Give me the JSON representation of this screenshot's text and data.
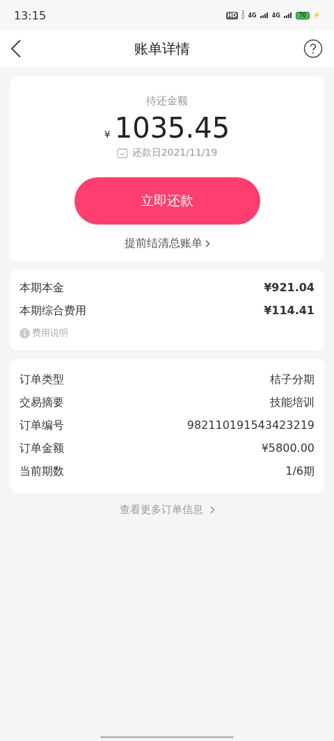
{
  "status_bar": {
    "time": "13:15",
    "hd": "HD",
    "hd_sims": [
      "1",
      "2"
    ],
    "networks": [
      "4G",
      "4G"
    ],
    "battery": "76",
    "charging": true
  },
  "nav": {
    "title": "账单详情"
  },
  "summary": {
    "label": "待还金额",
    "currency": "¥",
    "amount": "1035.45",
    "due": "还款日2021/11/19",
    "pay_button": "立即还款",
    "settle_link": "提前结清总账单"
  },
  "fees": {
    "rows": [
      {
        "label": "本期本金",
        "value": "¥921.04"
      },
      {
        "label": "本期综合费用",
        "value": "¥114.41"
      }
    ],
    "note": "费用说明"
  },
  "order": {
    "rows": [
      {
        "label": "订单类型",
        "value": "桔子分期"
      },
      {
        "label": "交易摘要",
        "value": "技能培训"
      },
      {
        "label": "订单编号",
        "value": "982110191543423219"
      },
      {
        "label": "订单金额",
        "value": "¥5800.00"
      },
      {
        "label": "当前期数",
        "value": "1/6期"
      }
    ]
  },
  "more_link": "查看更多订单信息"
}
